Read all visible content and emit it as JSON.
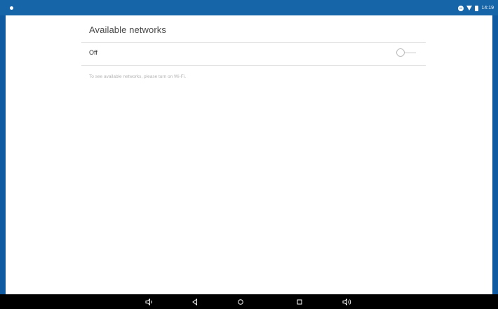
{
  "status_bar": {
    "left_icon": "notification-dot-icon",
    "icons": [
      "dnd-icon",
      "wifi-icon",
      "battery-icon"
    ],
    "time": "14:19"
  },
  "wifi_settings": {
    "section_title": "Available networks",
    "toggle": {
      "label": "Off",
      "state": "off"
    },
    "hint": "To see available networks, please turn on Wi-Fi."
  },
  "nav_bar": {
    "buttons": [
      "volume-down-icon",
      "back-icon",
      "home-icon",
      "recents-icon",
      "volume-up-icon"
    ]
  },
  "colors": {
    "frame": "#0f5aa0",
    "status_bar": "#1565a8",
    "content_bg": "#ffffff",
    "nav_bar": "#000000"
  }
}
